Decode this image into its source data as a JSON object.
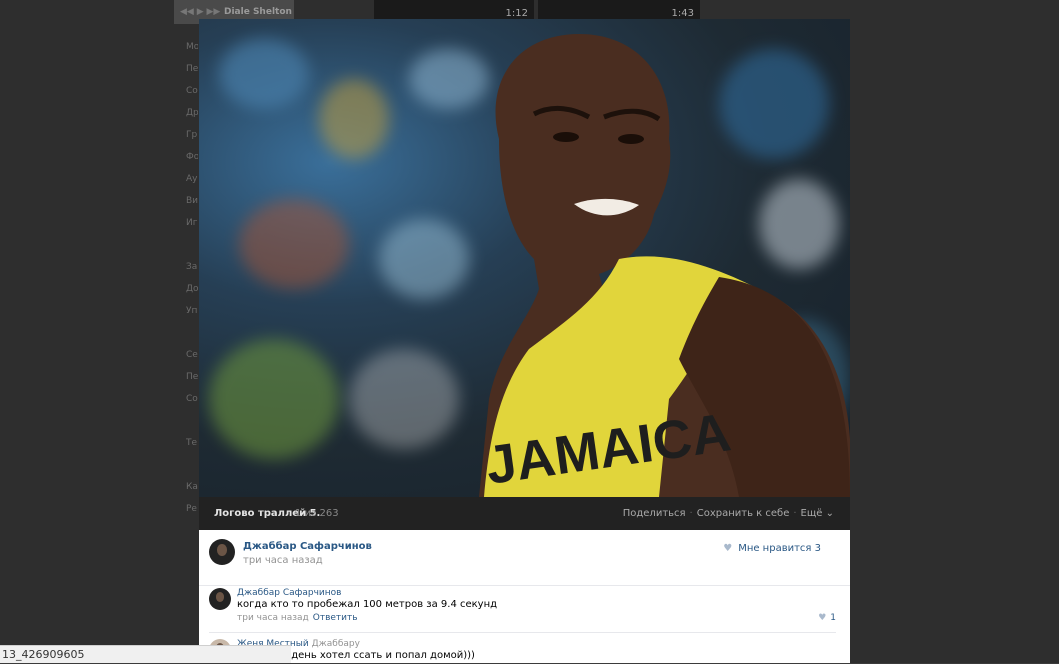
{
  "background": {
    "player_name": "Diale Shelton",
    "video_durations": [
      "1:12",
      "1:43"
    ],
    "menu_items": [
      "Mo",
      "Пе",
      "Со",
      "Др",
      "Гр",
      "Фо",
      "Ау",
      "Ви",
      "Иг",
      "",
      "За",
      "До",
      "Уп",
      "",
      "Се",
      "Пе",
      "Со",
      "",
      "Те",
      "",
      "Ка",
      "Ре"
    ]
  },
  "viewer": {
    "album_title": "Логово траллей 5.",
    "counter": "1 из 263",
    "actions": {
      "share": "Поделиться",
      "save": "Сохранить к себе",
      "more": "Ещё ⌄"
    },
    "author": {
      "name": "Джаббар Сафарчинов",
      "time": "три часа назад"
    },
    "likes": {
      "label": "Мне нравится",
      "count": "3"
    },
    "comments": [
      {
        "name": "Джаббар Сафарчинов",
        "text": "когда кто то пробежал 100 метров за 9.4 секунд",
        "time": "три часа назад",
        "reply": "Ответить",
        "likes": "1"
      },
      {
        "name": "Женя Местный",
        "reply_to": "Джаббару",
        "text": "огда весь день хотел ссать и попал домой)))"
      }
    ]
  },
  "status_bar": {
    "text": "13_426909605"
  },
  "colors": {
    "link": "#2a5885",
    "muted": "#939393",
    "dark_bar": "#222222"
  }
}
